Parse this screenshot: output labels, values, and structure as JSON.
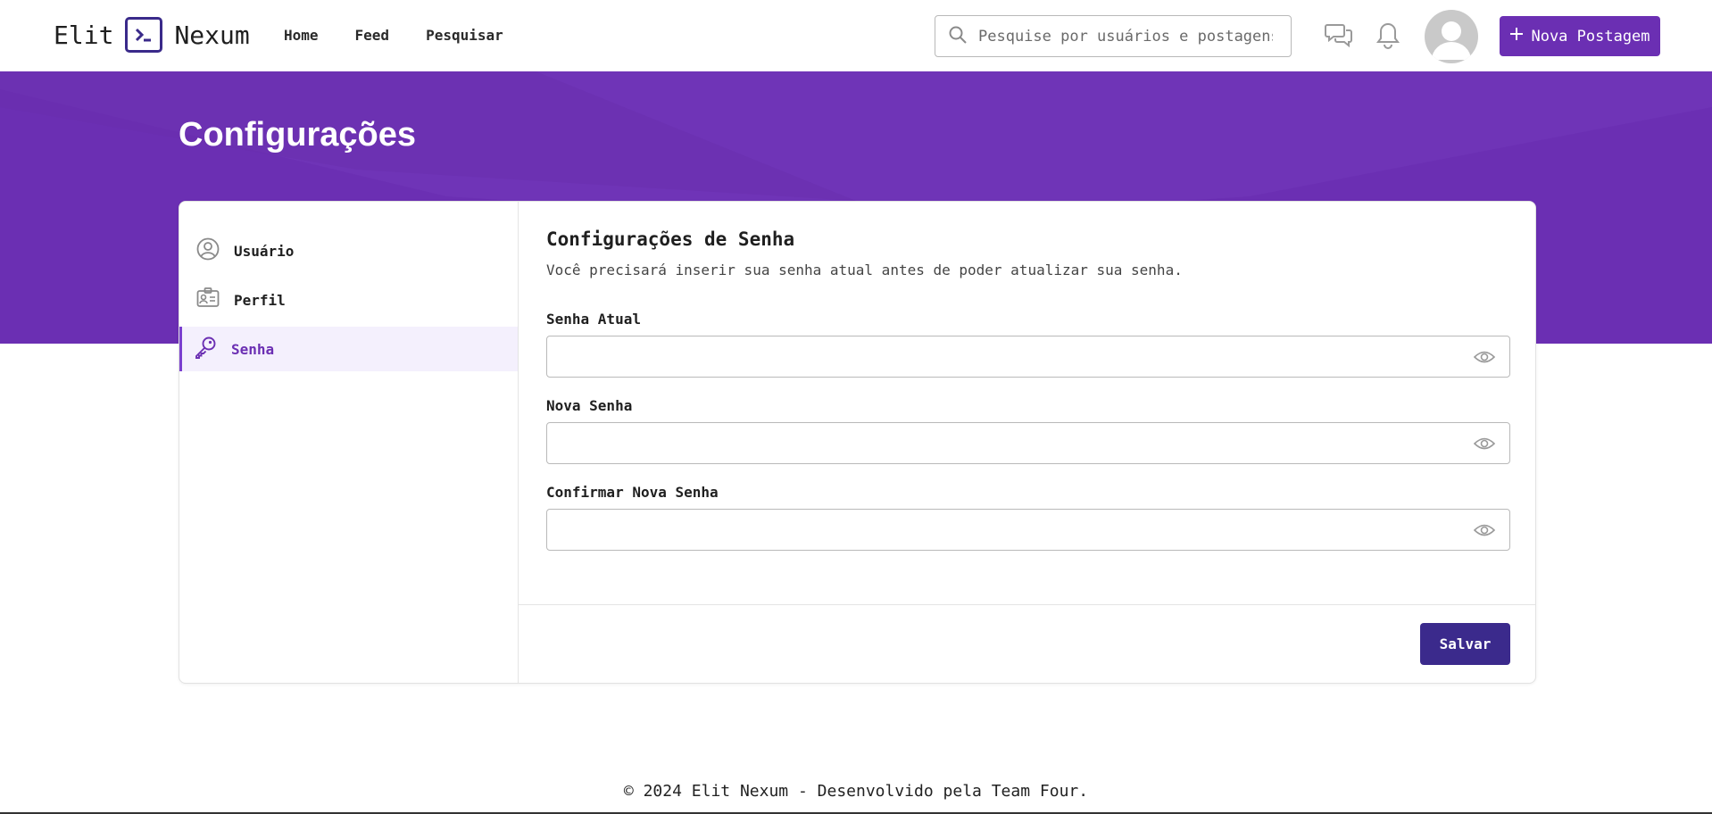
{
  "navbar": {
    "logo_left": "Elit",
    "logo_right": "Nexum",
    "links": [
      "Home",
      "Feed",
      "Pesquisar"
    ],
    "search_placeholder": "Pesquise por usuários e postagens",
    "new_post_label": "Nova Postagem"
  },
  "banner": {
    "title": "Configurações"
  },
  "sidebar": {
    "items": [
      {
        "label": "Usuário",
        "icon": "user-circle-icon"
      },
      {
        "label": "Perfil",
        "icon": "id-card-icon"
      },
      {
        "label": "Senha",
        "icon": "key-icon",
        "active": true
      }
    ]
  },
  "password_settings": {
    "title": "Configurações de Senha",
    "description": "Você precisará inserir sua senha atual antes de poder atualizar sua senha.",
    "fields": [
      {
        "label": "Senha Atual",
        "value": ""
      },
      {
        "label": "Nova Senha",
        "value": ""
      },
      {
        "label": "Confirmar Nova Senha",
        "value": ""
      }
    ],
    "save_label": "Salvar"
  },
  "footer": {
    "text": "© 2024 Elit Nexum - Desenvolvido pela Team Four."
  },
  "colors": {
    "brand_purple": "#6b2fb3",
    "save_button": "#3b2a8c",
    "active_item_bg": "#f4f0fd"
  }
}
